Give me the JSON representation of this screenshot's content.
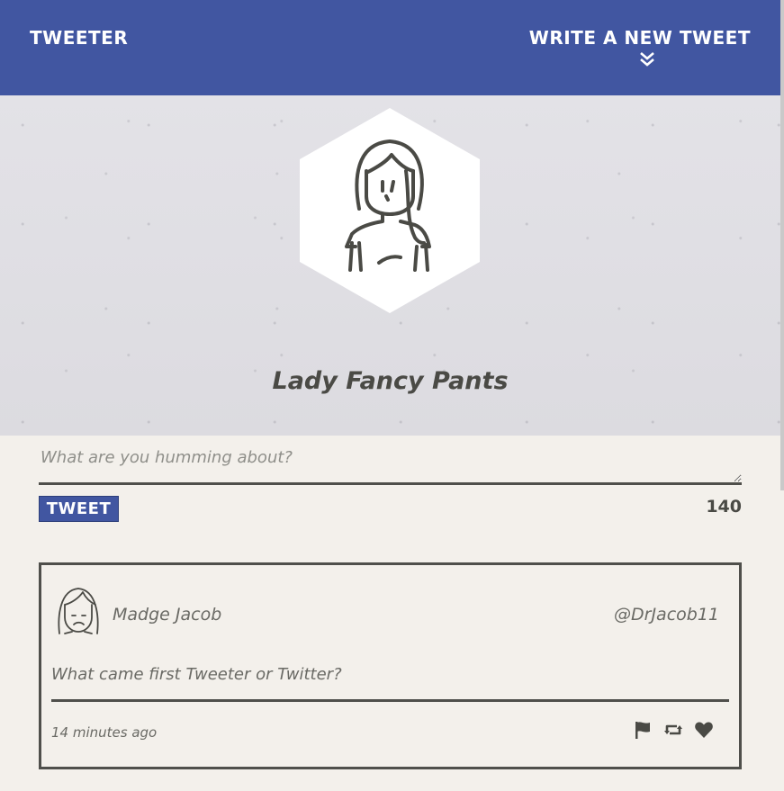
{
  "nav": {
    "brand": "TWEETER",
    "compose_toggle_label": "WRITE A NEW TWEET",
    "compose_toggle_icon": "double-chevron-down-icon"
  },
  "profile": {
    "name": "Lady Fancy Pants",
    "avatar_icon": "woman-avatar-icon"
  },
  "compose": {
    "placeholder": "What are you humming about?",
    "value": "",
    "submit_label": "TWEET",
    "char_counter": "140"
  },
  "tweets": [
    {
      "author_name": "Madge Jacob",
      "author_handle": "@DrJacob11",
      "text": "What came first Tweeter or Twitter?",
      "time": "14 minutes ago",
      "avatar_icon": "woman-avatar-icon",
      "actions": [
        "flag-icon",
        "retweet-icon",
        "heart-icon"
      ]
    }
  ],
  "colors": {
    "nav_bg": "#4156a1",
    "page_bg": "#f3f0eb",
    "header_bg": "#e0dfe4",
    "text_dark": "#4a4a45",
    "border": "#4f4f4b"
  }
}
